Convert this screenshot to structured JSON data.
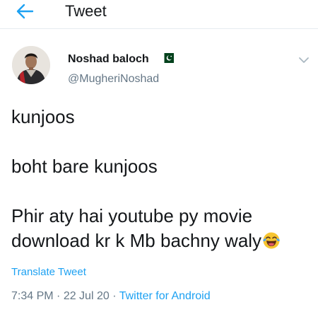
{
  "header": {
    "title": "Tweet",
    "back_icon": "arrow-left-icon"
  },
  "author": {
    "name": "Noshad baloch",
    "handle": "@MugheriNoshad",
    "flag_icon": "pakistan-flag-icon"
  },
  "tweet": {
    "lines": [
      "kunjoos",
      "boht bare kunjoos",
      "Phir aty hai youtube py movie",
      "download kr k Mb bachny waly"
    ],
    "emoji": "face-with-tears-of-joy-icon"
  },
  "translate_label": "Translate Tweet",
  "meta": {
    "time": "7:34 PM",
    "sep1": " · ",
    "date": "22 Jul 20",
    "sep2": " · ",
    "source": "Twitter for Android"
  },
  "colors": {
    "accent": "#1da1f2",
    "muted": "#657786",
    "text": "#14171a"
  }
}
